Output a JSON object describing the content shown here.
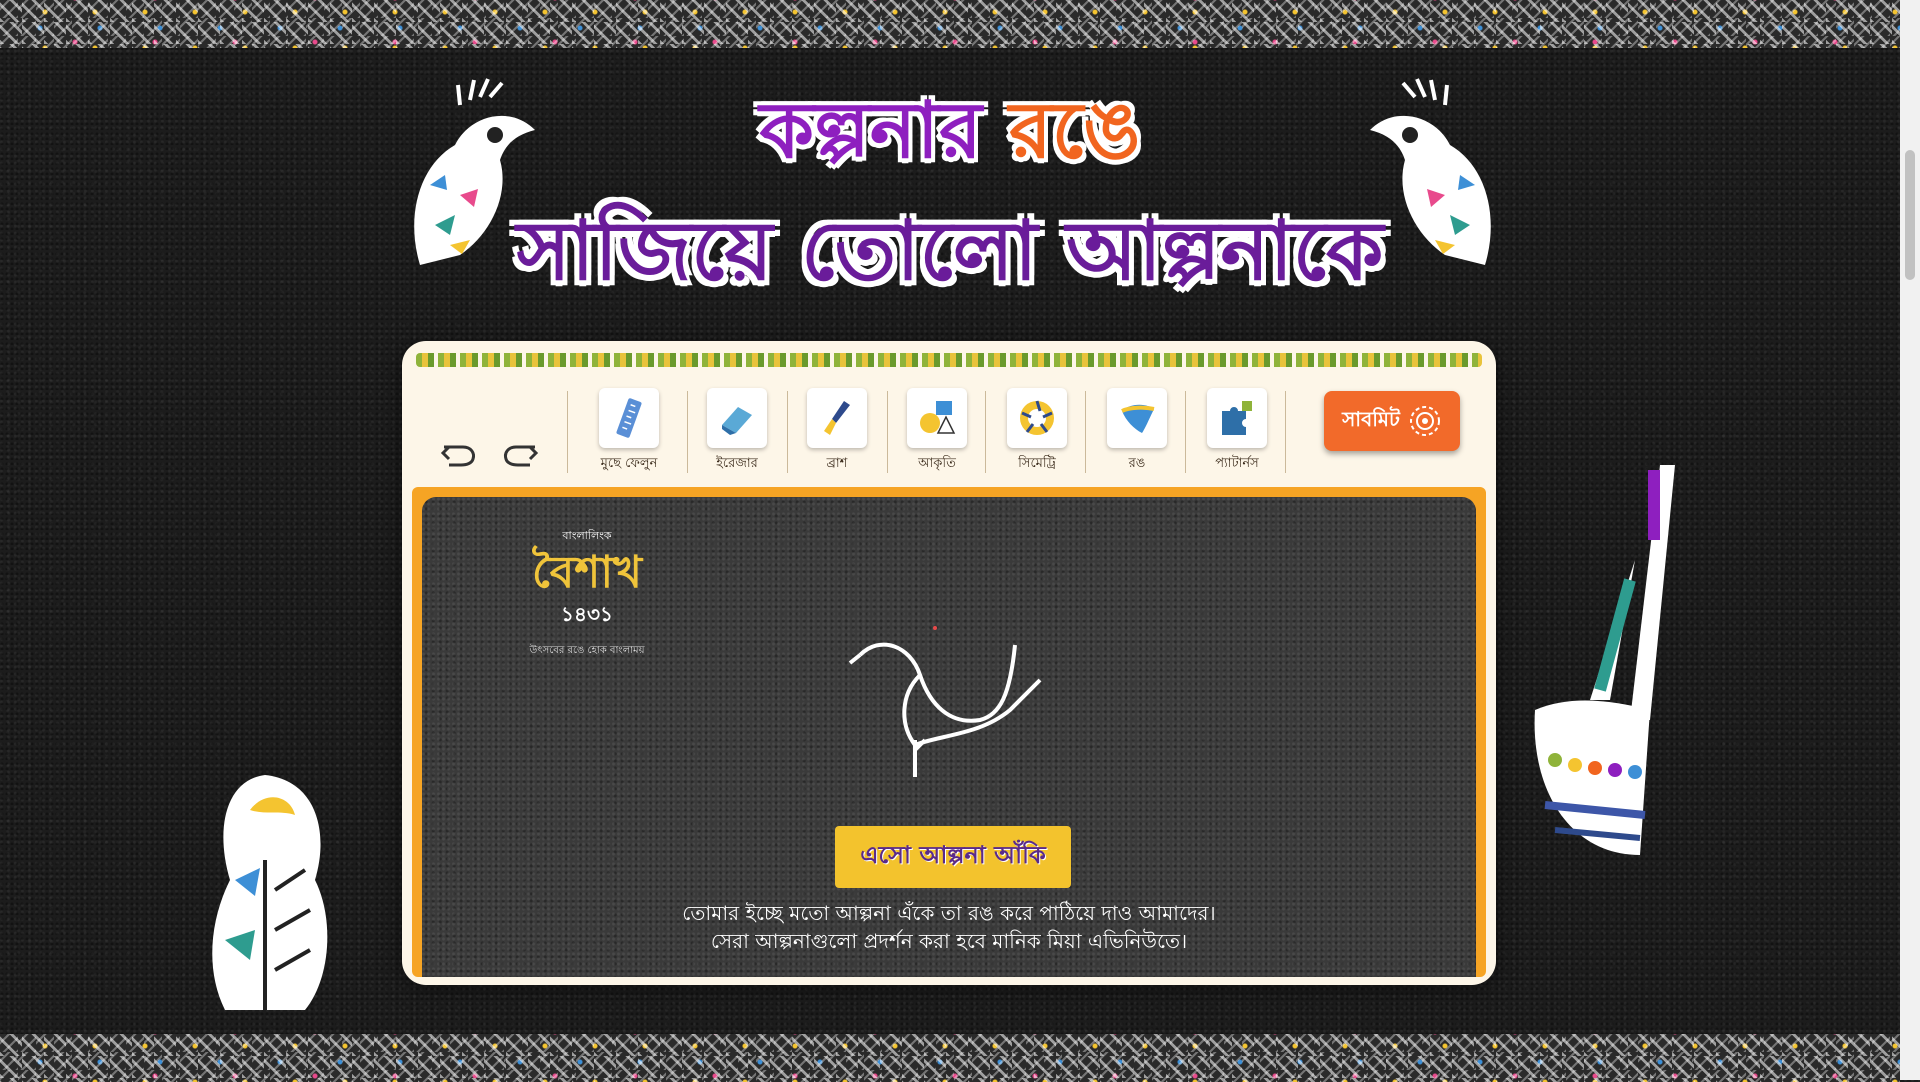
{
  "header": {
    "title_line1_a": "কল্পনার",
    "title_line1_b": "রঙে",
    "title_line2": "সাজিয়ে তোলো আল্পনাকে"
  },
  "toolbar": {
    "tools": [
      {
        "label": "মুছে ফেলুন",
        "icon": "ruler-icon"
      },
      {
        "label": "ইরেজার",
        "icon": "eraser-icon"
      },
      {
        "label": "ব্রাশ",
        "icon": "brush-icon"
      },
      {
        "label": "আকৃতি",
        "icon": "shapes-icon"
      },
      {
        "label": "সিমেট্রি",
        "icon": "symmetry-icon"
      },
      {
        "label": "রঙ",
        "icon": "color-icon"
      },
      {
        "label": "প্যাটার্নস",
        "icon": "puzzle-icon"
      }
    ],
    "submit_label": "সাবমিট"
  },
  "canvas": {
    "logo_top": "বাংলালিংক",
    "logo_main": "বৈশাখ",
    "logo_year": "১৪৩১",
    "logo_sub": "উৎসবের রঙে হোক বাংলাময়",
    "start_button": "এসো আল্পনা আঁকি",
    "desc_line1": "তোমার ইচ্ছে মতো আল্পনা এঁকে তা রঙ করে পাঠিয়ে দাও আমাদের।",
    "desc_line2": "সেরা আল্পনাগুলো প্রদর্শন করা হবে মানিক মিয়া এভিনিউতে।"
  },
  "colors": {
    "title_purple": "#8e1fbf",
    "title_orange": "#f1651f",
    "submit_orange": "#f26a2a",
    "start_yellow": "#f3c32d",
    "frame_orange": "#f6a424"
  }
}
